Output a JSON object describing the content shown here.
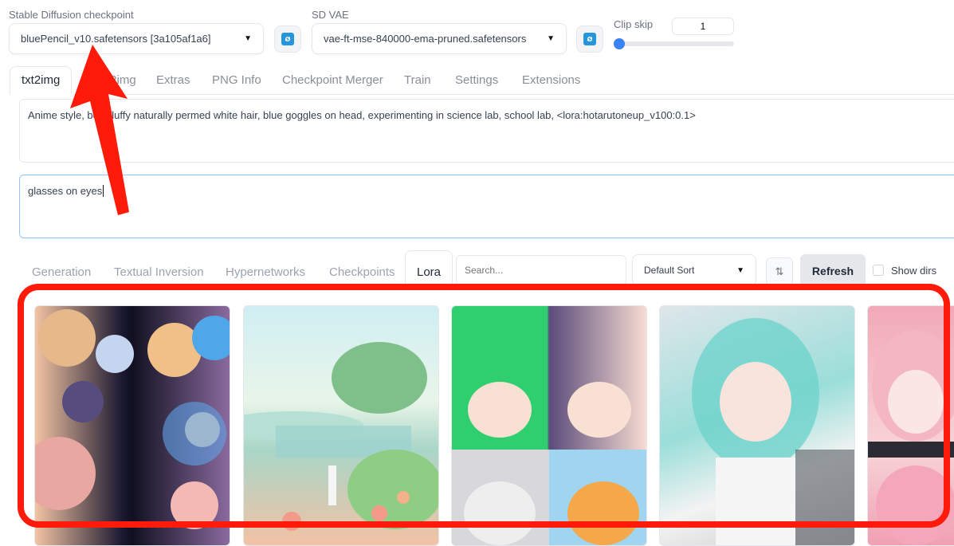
{
  "settings": {
    "checkpoint_label": "Stable Diffusion checkpoint",
    "checkpoint_value": "bluePencil_v10.safetensors [3a105af1a6]",
    "vae_label": "SD VAE",
    "vae_value": "vae-ft-mse-840000-ema-pruned.safetensors",
    "clipskip_label": "Clip skip",
    "clipskip_value": "1",
    "clipskip_level": 0.0
  },
  "tabs": [
    {
      "label": "txt2img",
      "active": true
    },
    {
      "label": "img2img",
      "active": false
    },
    {
      "label": "Extras",
      "active": false
    },
    {
      "label": "PNG Info",
      "active": false
    },
    {
      "label": "Checkpoint Merger",
      "active": false
    },
    {
      "label": "Train",
      "active": false
    },
    {
      "label": "Settings",
      "active": false
    },
    {
      "label": "Extensions",
      "active": false
    }
  ],
  "prompt": {
    "positive": "Anime style, boy, fluffy naturally permed white hair, blue goggles on head, experimenting in science lab, school lab,  <lora:hotarutoneup_v100:0.1>",
    "negative": "glasses on eyes"
  },
  "network_tabs": [
    {
      "label": "Generation",
      "active": false
    },
    {
      "label": "Textual Inversion",
      "active": false
    },
    {
      "label": "Hypernetworks",
      "active": false
    },
    {
      "label": "Checkpoints",
      "active": false
    },
    {
      "label": "Lora",
      "active": true
    }
  ],
  "network_toolbar": {
    "search_placeholder": "Search...",
    "sort_value": "Default Sort",
    "sort_direction_icon": "sort-arrows-icon",
    "refresh_label": "Refresh",
    "show_dirs_label": "Show dirs"
  },
  "annotations": {
    "arrow_color": "#ff1a0a",
    "box_color": "#ff1a0a"
  },
  "colors": {
    "accent_blue": "#2596dc",
    "slider_blue": "#3b82f6"
  }
}
